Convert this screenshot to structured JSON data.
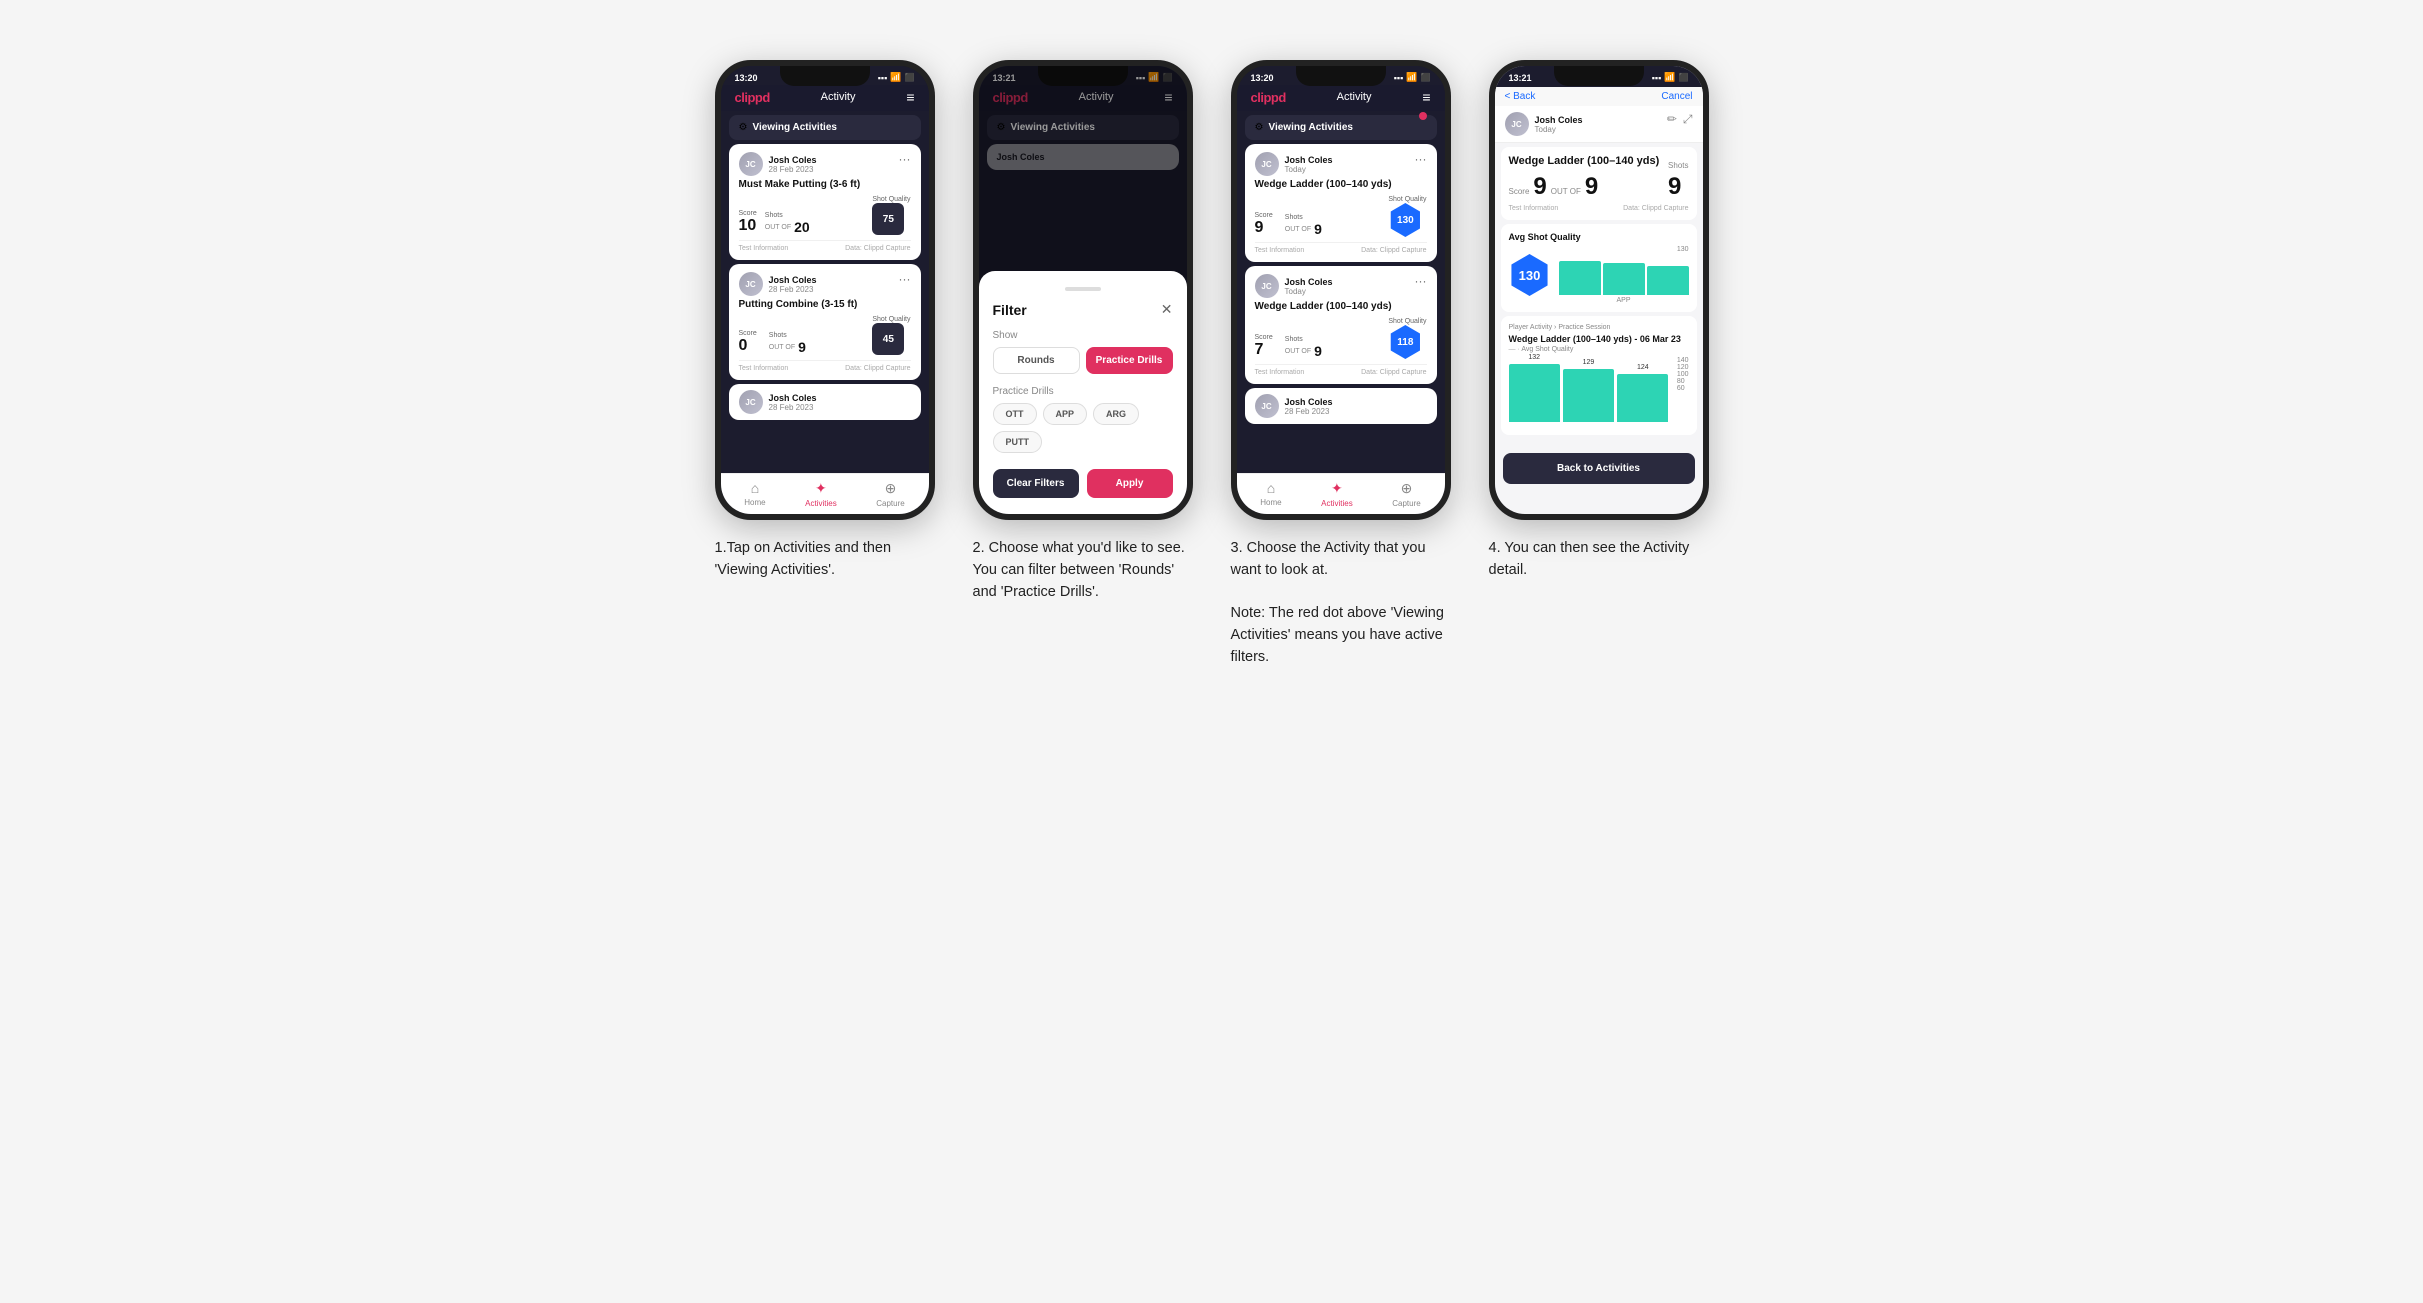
{
  "phones": [
    {
      "id": "phone1",
      "time": "13:20",
      "nav": {
        "logo": "clippd",
        "title": "Activity",
        "menu": "≡"
      },
      "viewingBar": {
        "label": "Viewing Activities",
        "hasRedDot": false
      },
      "cards": [
        {
          "user": "Josh Coles",
          "date": "28 Feb 2023",
          "title": "Must Make Putting (3-6 ft)",
          "score": "10",
          "outOf": "20",
          "shots": "20",
          "quality": "75",
          "qualityType": "square",
          "footerLeft": "Test Information",
          "footerRight": "Data: Clippd Capture"
        },
        {
          "user": "Josh Coles",
          "date": "28 Feb 2023",
          "title": "Putting Combine (3-15 ft)",
          "score": "0",
          "outOf": "9",
          "shots": "9",
          "quality": "45",
          "qualityType": "square",
          "footerLeft": "Test Information",
          "footerRight": "Data: Clippd Capture"
        }
      ],
      "bottomNav": [
        {
          "label": "Home",
          "icon": "⌂",
          "active": false
        },
        {
          "label": "Activities",
          "icon": "♪",
          "active": true
        },
        {
          "label": "Capture",
          "icon": "⊕",
          "active": false
        }
      ]
    },
    {
      "id": "phone2",
      "time": "13:21",
      "nav": {
        "logo": "clippd",
        "title": "Activity",
        "menu": "≡"
      },
      "viewingBar": {
        "label": "Viewing Activities",
        "hasRedDot": false
      },
      "filter": {
        "title": "Filter",
        "showLabel": "Show",
        "toggles": [
          {
            "label": "Rounds",
            "active": false
          },
          {
            "label": "Practice Drills",
            "active": true
          }
        ],
        "practiceLabel": "Practice Drills",
        "pills": [
          "OTT",
          "APP",
          "ARG",
          "PUTT"
        ],
        "clearLabel": "Clear Filters",
        "applyLabel": "Apply"
      }
    },
    {
      "id": "phone3",
      "time": "13:20",
      "nav": {
        "logo": "clippd",
        "title": "Activity",
        "menu": "≡"
      },
      "viewingBar": {
        "label": "Viewing Activities",
        "hasRedDot": true
      },
      "cards": [
        {
          "user": "Josh Coles",
          "date": "Today",
          "title": "Wedge Ladder (100–140 yds)",
          "score": "9",
          "outOf": "9",
          "shots": "9",
          "quality": "130",
          "qualityType": "hex",
          "footerLeft": "Test Information",
          "footerRight": "Data: Clippd Capture"
        },
        {
          "user": "Josh Coles",
          "date": "Today",
          "title": "Wedge Ladder (100–140 yds)",
          "score": "7",
          "outOf": "9",
          "shots": "9",
          "quality": "118",
          "qualityType": "hex",
          "footerLeft": "Test Information",
          "footerRight": "Data: Clippd Capture"
        },
        {
          "user": "Josh Coles",
          "date": "28 Feb 2023",
          "title": "",
          "score": "",
          "outOf": "",
          "shots": "",
          "quality": "",
          "qualityType": "",
          "footerLeft": "",
          "footerRight": ""
        }
      ],
      "bottomNav": [
        {
          "label": "Home",
          "icon": "⌂",
          "active": false
        },
        {
          "label": "Activities",
          "icon": "♪",
          "active": true
        },
        {
          "label": "Capture",
          "icon": "⊕",
          "active": false
        }
      ]
    },
    {
      "id": "phone4",
      "time": "13:21",
      "back": "< Back",
      "cancel": "Cancel",
      "user": "Josh Coles",
      "userDate": "Today",
      "detailTitle": "Wedge Ladder (100–140 yds)",
      "scoreLabel": "Score",
      "shotsLabel": "Shots",
      "score": "9",
      "outOf": "OUT OF",
      "shots": "9",
      "infoLabel": "Test Information",
      "dataLabel": "Data: Clippd Capture",
      "avgShotQuality": "Avg Shot Quality",
      "qualityValue": "130",
      "chartValues": [
        132,
        129,
        124
      ],
      "chartLabel": "APP",
      "playerActivity": "Player Activity",
      "practiceSession": "Practice Session",
      "sessionTitle": "Wedge Ladder (100–140 yds) - 06 Mar 23",
      "sessionSubtitle": "Avg Shot Quality",
      "backBtn": "Back to Activities"
    }
  ],
  "captions": [
    "1.Tap on Activities and then 'Viewing Activities'.",
    "2. Choose what you'd like to see. You can filter between 'Rounds' and 'Practice Drills'.",
    "3. Choose the Activity that you want to look at.\n\nNote: The red dot above 'Viewing Activities' means you have active filters.",
    "4. You can then see the Activity detail."
  ]
}
